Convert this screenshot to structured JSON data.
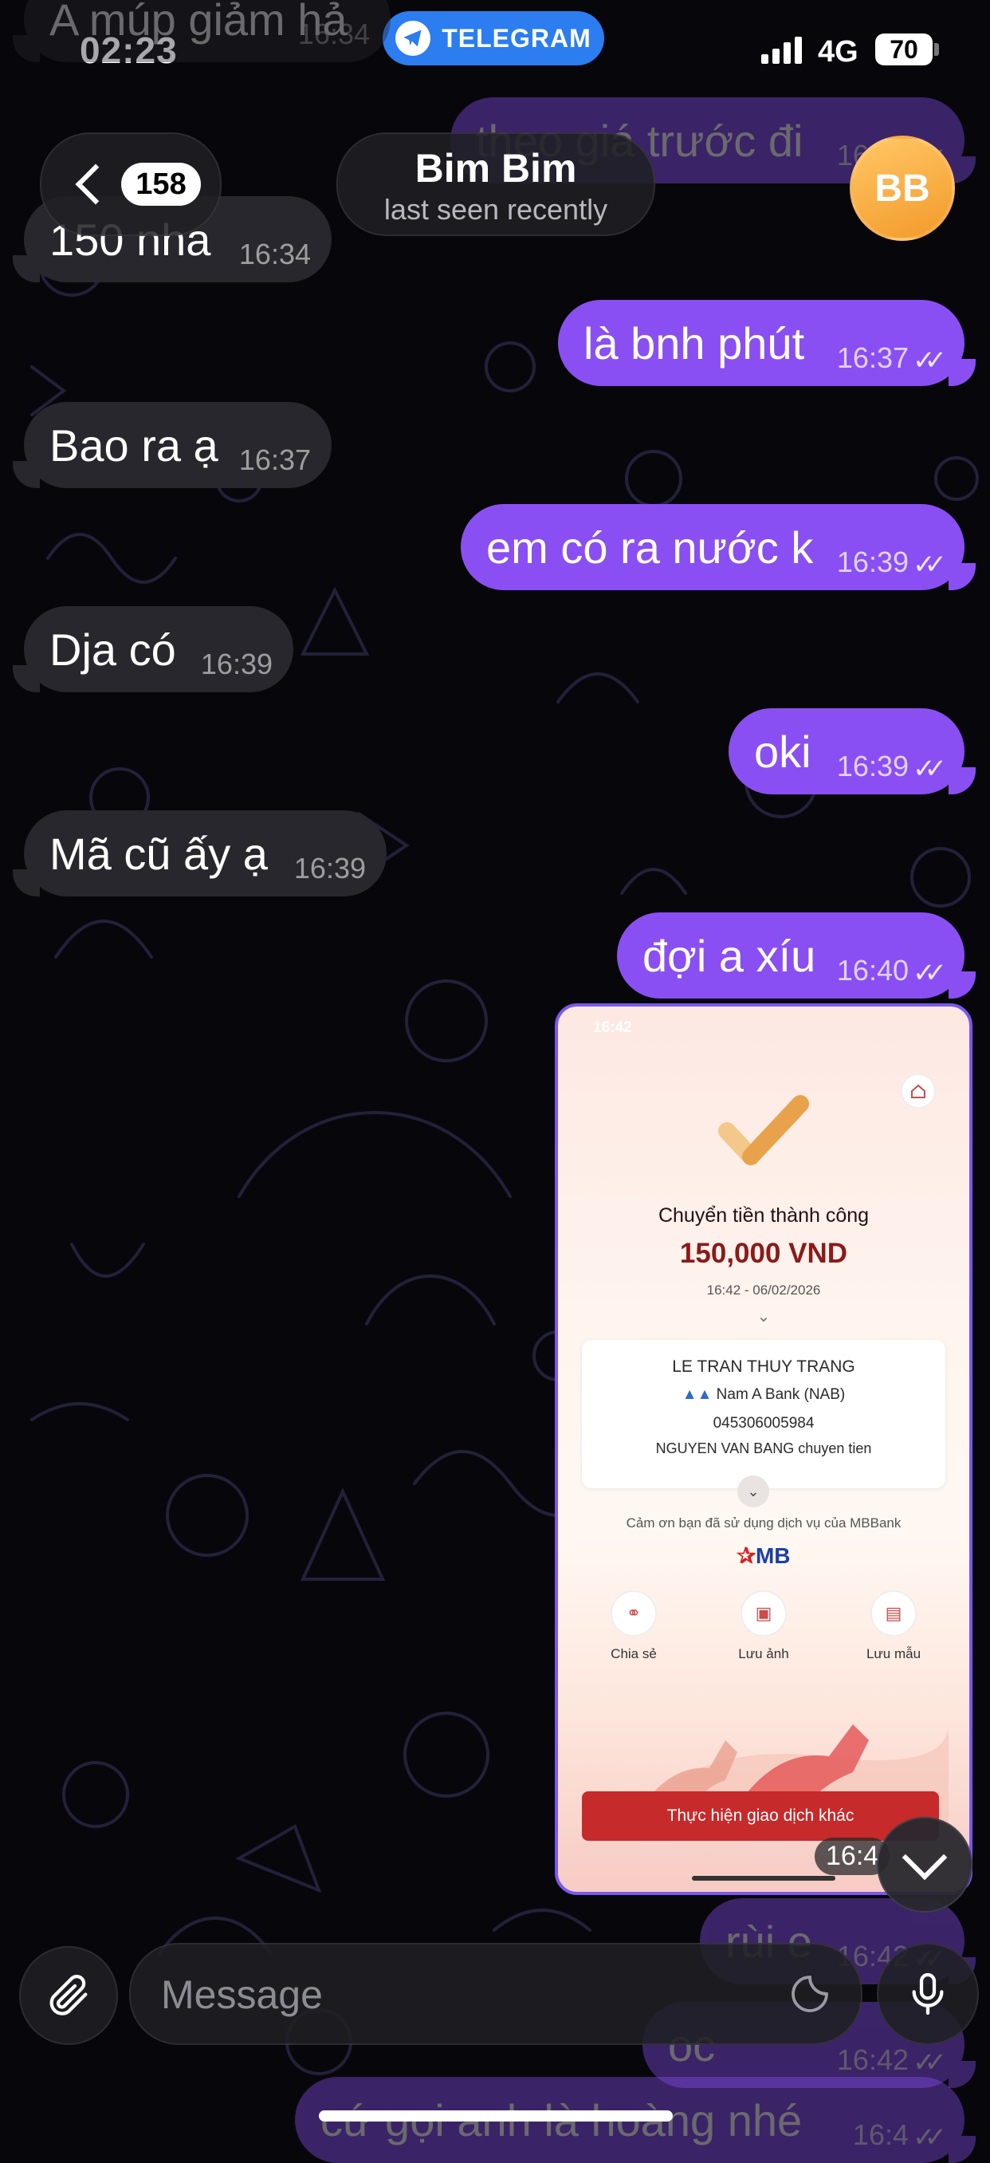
{
  "status_bar": {
    "time": "02:23",
    "source_app": "TELEGRAM",
    "network": "4G",
    "battery": "70"
  },
  "header": {
    "back_count": "158",
    "chat_name": "Bim Bim",
    "chat_status": "last seen recently",
    "avatar_initials": "BB"
  },
  "messages": [
    {
      "dir": "in",
      "text": "A múp giảm hả",
      "time": "16:34"
    },
    {
      "dir": "out",
      "text": "theo giá trước đi",
      "time": "16:34"
    },
    {
      "dir": "in",
      "text": "150 nha",
      "time": "16:34"
    },
    {
      "dir": "out",
      "text": "là bnh phút",
      "time": "16:37"
    },
    {
      "dir": "in",
      "text": "Bao ra ạ",
      "time": "16:37"
    },
    {
      "dir": "out",
      "text": "em có ra nước k",
      "time": "16:39"
    },
    {
      "dir": "in",
      "text": "Dja có",
      "time": "16:39"
    },
    {
      "dir": "out",
      "text": "oki",
      "time": "16:39"
    },
    {
      "dir": "in",
      "text": "Mã cũ ấy ạ",
      "time": "16:39"
    },
    {
      "dir": "out",
      "text": "đợi a xíu",
      "time": "16:40"
    },
    {
      "dir": "out",
      "text": "rùi e",
      "time": "16:42"
    },
    {
      "dir": "out",
      "text": "oc",
      "time": "16:42"
    },
    {
      "dir": "out",
      "text": "cứ gọi anh là hoàng nhé",
      "time": "16:4"
    }
  ],
  "receipt": {
    "phone_time": "16:42",
    "title": "Chuyển tiền thành công",
    "amount": "150,000 VND",
    "datetime": "16:42 - 06/02/2026",
    "recipient_name": "LE TRAN THUY TRANG",
    "bank": "Nam A Bank (NAB)",
    "account": "045306005984",
    "memo": "NGUYEN VAN BANG chuyen tien",
    "thanks": "Cảm ơn bạn đã sử dụng dịch vụ của MBBank",
    "logo": "MB",
    "actions": [
      "Chia sẻ",
      "Lưu ảnh",
      "Lưu mẫu"
    ],
    "button": "Thực hiện giao dịch khác",
    "time_badge": "16:4"
  },
  "input": {
    "placeholder": "Message"
  },
  "colors": {
    "incoming_bubble": "#27272d",
    "outgoing_bubble": "#8a4ff2",
    "telegram_blue": "#2b7df0",
    "avatar_orange": "#f5a23a",
    "mb_red": "#c62a2a",
    "mb_blue": "#1b3fa8"
  },
  "icons": [
    "telegram-icon",
    "signal-icon",
    "battery-icon",
    "back-chevron-icon",
    "double-check-icon",
    "paperclip-icon",
    "sticker-icon",
    "microphone-icon",
    "chevron-down-icon"
  ]
}
